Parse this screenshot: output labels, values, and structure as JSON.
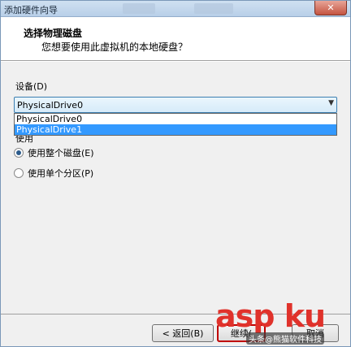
{
  "window": {
    "title": "添加硬件向导",
    "close_glyph": "✕"
  },
  "header": {
    "title": "选择物理磁盘",
    "subtitle": "您想要使用此虚拟机的本地硬盘？"
  },
  "device": {
    "label": "设备(D)",
    "selected": "PhysicalDrive0",
    "options": [
      "PhysicalDrive0",
      "PhysicalDrive1"
    ],
    "highlighted_option": "PhysicalDrive1"
  },
  "usage": {
    "label": "使用",
    "options": [
      {
        "label": "使用整个磁盘(E)",
        "checked": true
      },
      {
        "label": "使用单个分区(P)",
        "checked": false
      }
    ]
  },
  "footer": {
    "back_label": "< 返回(B)",
    "next_label": "继续(",
    "cancel_label": "取消"
  },
  "watermark": {
    "big": "asp ku",
    "small": "头条@熊猫软件科技"
  },
  "colors": {
    "selection": "#3399ff",
    "titlebar": "#b8cfe8",
    "close": "#c45441",
    "watermark": "#e0322b"
  }
}
